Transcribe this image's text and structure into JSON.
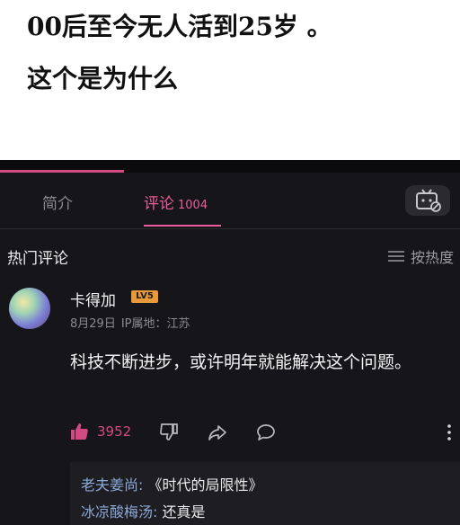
{
  "caption": {
    "line1": "00后至今无人活到25岁 。",
    "line2": "这个是为什么"
  },
  "progress": {
    "fraction": 0.27,
    "color": "#d24a82"
  },
  "tabs": {
    "intro": "简介",
    "comments": "评论",
    "comments_count": "1004"
  },
  "tv_icon": "tv-mascot-icon",
  "hot_header": "热门评论",
  "sort": {
    "label": "按热度",
    "icon": "list-sort-icon"
  },
  "comment": {
    "username": "卡得加",
    "level": "LV5",
    "date": "8月29日",
    "ip_location": "IP属地：江苏",
    "text": "科技不断进步，或许明年就能解决这个问题。",
    "like_count": "3952",
    "accent": "#ea5d9a"
  },
  "replies": [
    {
      "user": "老夫姜尚:",
      "text": " 《时代的局限性》"
    },
    {
      "user": "冰凉酸梅汤:",
      "text": " 还真是"
    }
  ]
}
